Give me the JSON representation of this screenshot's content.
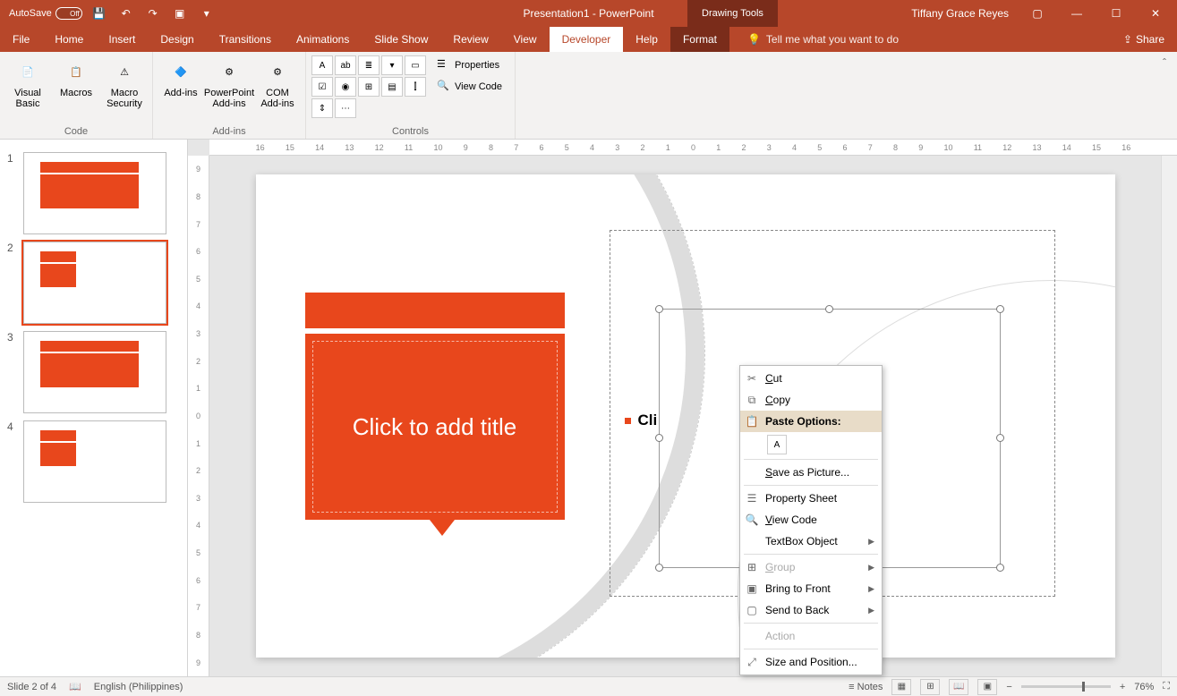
{
  "titlebar": {
    "autosave_label": "AutoSave",
    "autosave_state": "Off",
    "title": "Presentation1 - PowerPoint",
    "drawing_tools": "Drawing Tools",
    "user": "Tiffany Grace Reyes"
  },
  "tabs": {
    "file": "File",
    "home": "Home",
    "insert": "Insert",
    "design": "Design",
    "transitions": "Transitions",
    "animations": "Animations",
    "slideshow": "Slide Show",
    "review": "Review",
    "view": "View",
    "developer": "Developer",
    "help": "Help",
    "format": "Format",
    "tellme": "Tell me what you want to do",
    "share": "Share"
  },
  "ribbon": {
    "code_group": "Code",
    "visual_basic": "Visual Basic",
    "macros": "Macros",
    "macro_security": "Macro Security",
    "addins_group": "Add-ins",
    "addins": "Add-ins",
    "ppt_addins": "PowerPoint Add-ins",
    "com_addins": "COM Add-ins",
    "controls_group": "Controls",
    "properties": "Properties",
    "view_code": "View Code"
  },
  "slide": {
    "title_placeholder": "Click to add title",
    "content_placeholder": "Cli"
  },
  "thumbs": {
    "n1": "1",
    "n2": "2",
    "n3": "3",
    "n4": "4"
  },
  "context": {
    "cut": "Cut",
    "copy": "Copy",
    "paste_options": "Paste Options:",
    "save_picture": "Save as Picture...",
    "property_sheet": "Property Sheet",
    "view_code": "View Code",
    "textbox_object": "TextBox Object",
    "group": "Group",
    "bring_front": "Bring to Front",
    "send_back": "Send to Back",
    "action": "Action",
    "size_position": "Size and Position..."
  },
  "status": {
    "slide_info": "Slide 2 of 4",
    "language": "English (Philippines)",
    "notes": "Notes",
    "zoom": "76%"
  },
  "ruler_h": [
    "16",
    "15",
    "14",
    "13",
    "12",
    "11",
    "10",
    "9",
    "8",
    "7",
    "6",
    "5",
    "4",
    "3",
    "2",
    "1",
    "0",
    "1",
    "2",
    "3",
    "4",
    "5",
    "6",
    "7",
    "8",
    "9",
    "10",
    "11",
    "12",
    "13",
    "14",
    "15",
    "16"
  ],
  "ruler_v": [
    "9",
    "8",
    "7",
    "6",
    "5",
    "4",
    "3",
    "2",
    "1",
    "0",
    "1",
    "2",
    "3",
    "4",
    "5",
    "6",
    "7",
    "8",
    "9"
  ]
}
